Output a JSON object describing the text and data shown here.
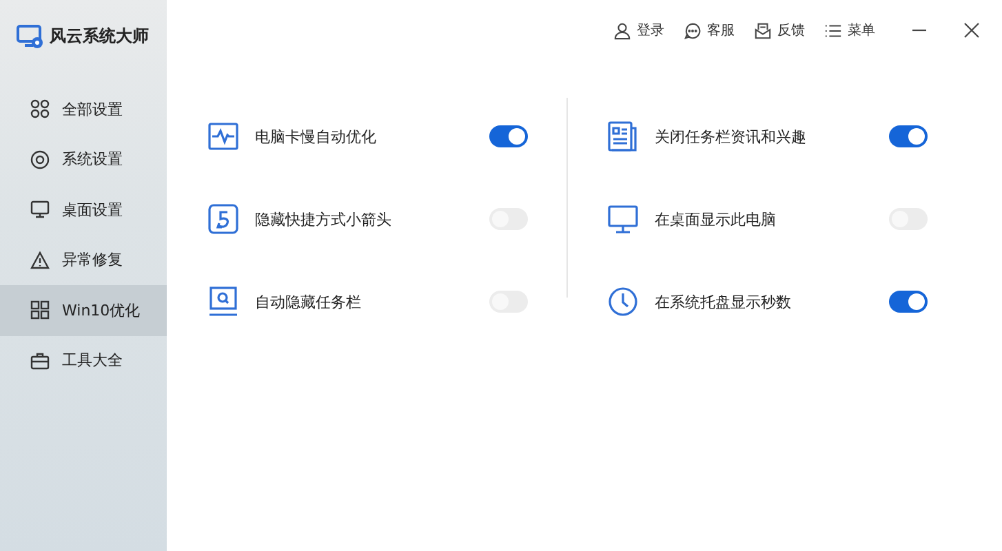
{
  "app": {
    "title": "风云系统大师"
  },
  "header_actions": [
    {
      "label": "登录"
    },
    {
      "label": "客服"
    },
    {
      "label": "反馈"
    },
    {
      "label": "菜单"
    }
  ],
  "sidebar": {
    "items": [
      {
        "label": "全部设置",
        "selected": false
      },
      {
        "label": "系统设置",
        "selected": false
      },
      {
        "label": "桌面设置",
        "selected": false
      },
      {
        "label": "异常修复",
        "selected": false
      },
      {
        "label": "Win10优化",
        "selected": true
      },
      {
        "label": "工具大全",
        "selected": false
      }
    ]
  },
  "settings": {
    "columns": [
      {
        "items": [
          {
            "label": "电脑卡慢自动优化",
            "on": true
          },
          {
            "label": "隐藏快捷方式小箭头",
            "on": false
          },
          {
            "label": "自动隐藏任务栏",
            "on": false
          }
        ]
      },
      {
        "items": [
          {
            "label": "关闭任务栏资讯和兴趣",
            "on": true
          },
          {
            "label": "在桌面显示此电脑",
            "on": false
          },
          {
            "label": "在系统托盘显示秒数",
            "on": true
          }
        ]
      }
    ]
  }
}
